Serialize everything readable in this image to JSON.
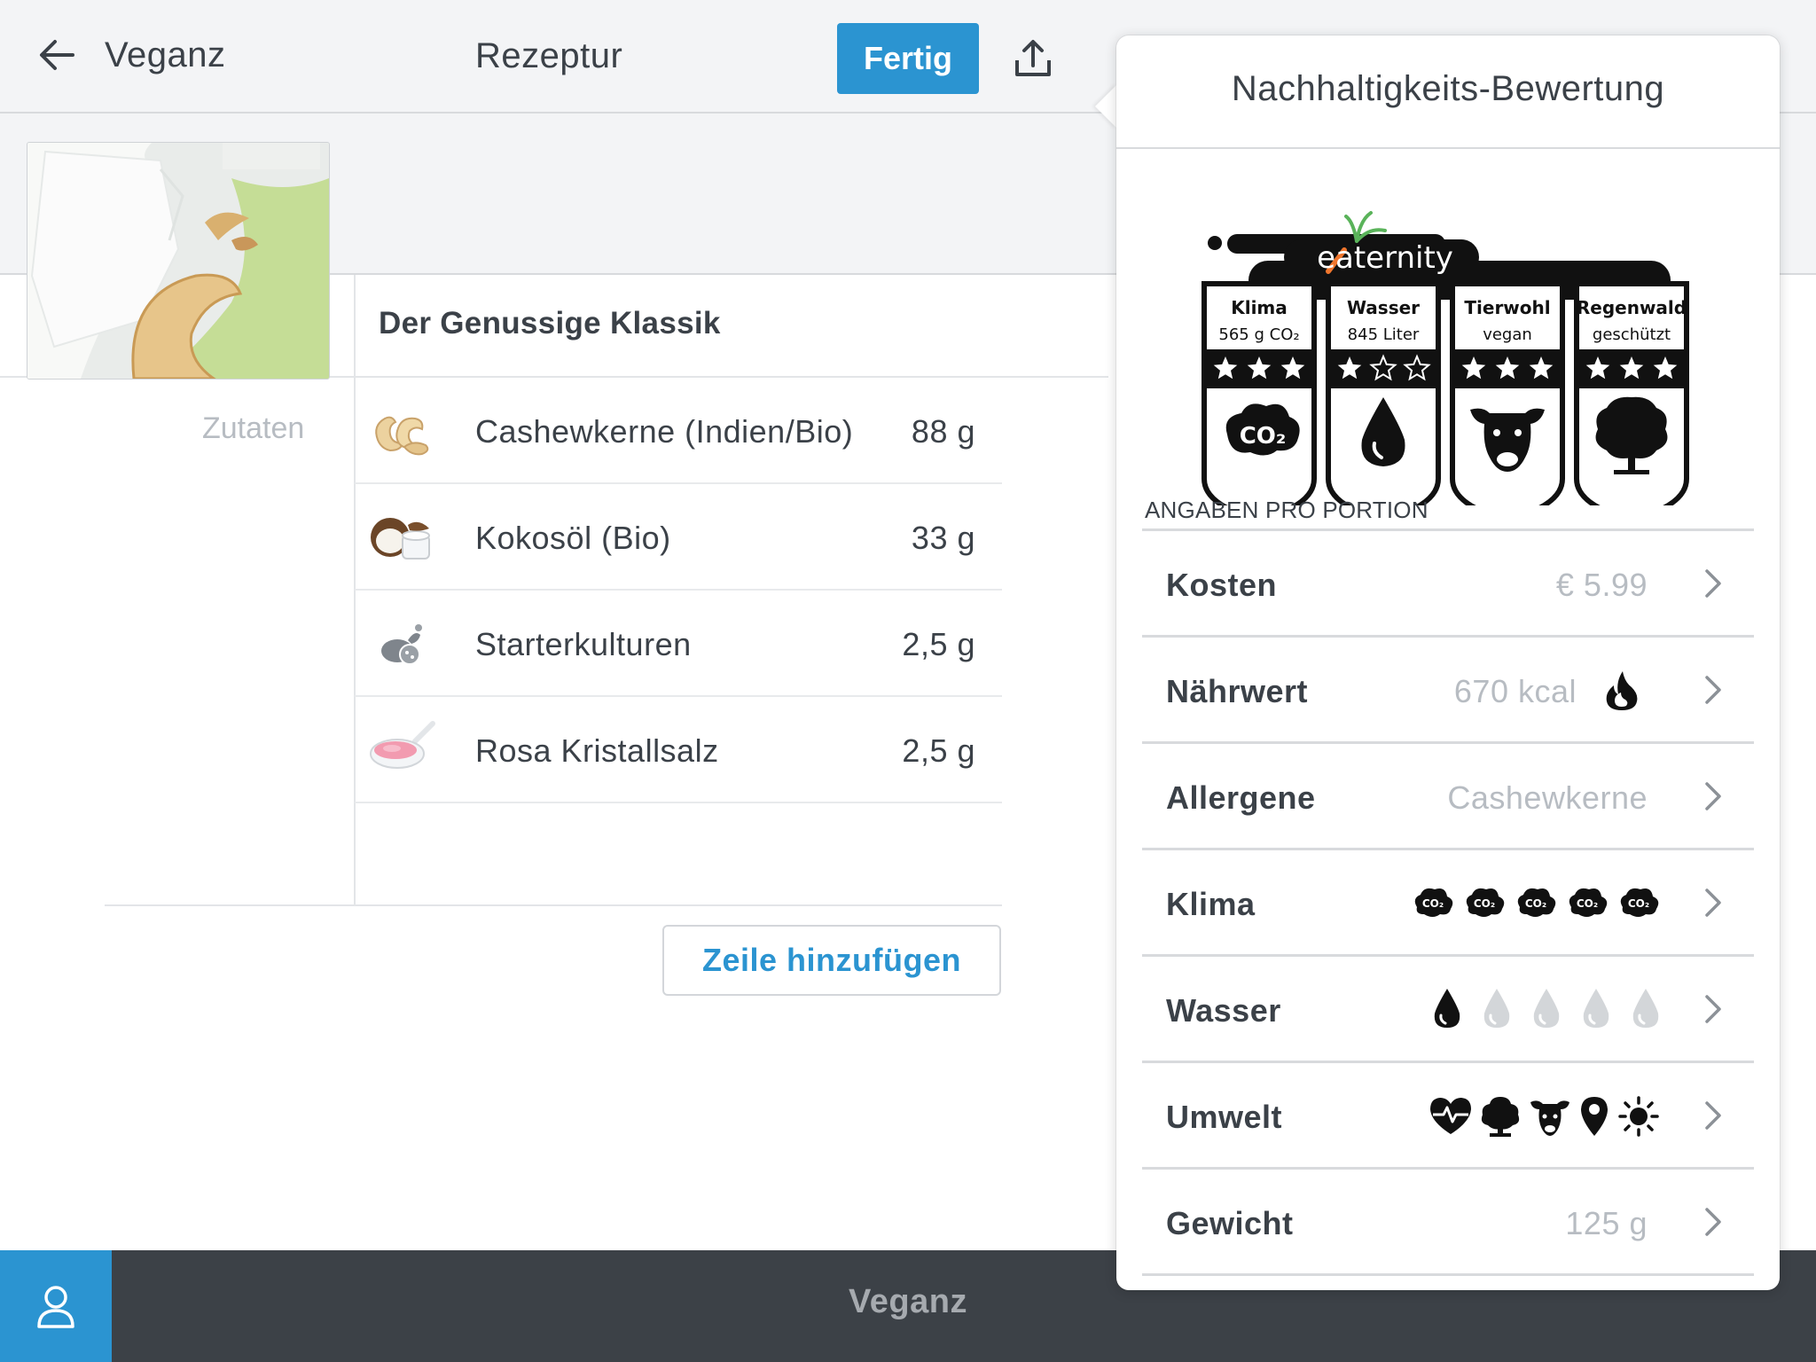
{
  "topbar": {
    "app_name": "Veganz",
    "title": "Rezeptur",
    "done_label": "Fertig"
  },
  "recipe": {
    "title": "Der Genussige Klassik",
    "ingredients_label": "Zutaten",
    "ingredients": [
      {
        "name": "Cashewkerne (Indien/Bio)",
        "amount": "88 g",
        "icon": "cashew-icon"
      },
      {
        "name": "Kokosöl (Bio)",
        "amount": "33 g",
        "icon": "coconut-icon"
      },
      {
        "name": "Starterkulturen",
        "amount": "2,5 g",
        "icon": "starter-culture-icon"
      },
      {
        "name": "Rosa Kristallsalz",
        "amount": "2,5 g",
        "icon": "pink-salt-icon"
      }
    ],
    "add_row_label": "Zeile hinzufügen"
  },
  "footer": {
    "title": "Veganz"
  },
  "popover": {
    "title": "Nachhaltigkeits-Bewertung",
    "label": {
      "brand": "eaternity",
      "columns": [
        {
          "name": "Klima",
          "value": "565 g CO₂",
          "stars": 3,
          "icon": "co2-cloud-icon"
        },
        {
          "name": "Wasser",
          "value": "845 Liter",
          "stars": 1,
          "icon": "water-drop-icon"
        },
        {
          "name": "Tierwohl",
          "value": "vegan",
          "stars": 3,
          "icon": "cow-icon"
        },
        {
          "name": "Regenwald",
          "value": "geschützt",
          "stars": 3,
          "icon": "tree-icon"
        }
      ]
    },
    "section_heading": "ANGABEN PRO PORTION",
    "metrics": {
      "cost": {
        "label": "Kosten",
        "value": "€ 5.99"
      },
      "nutrition": {
        "label": "Nährwert",
        "value": "670 kcal"
      },
      "allergens": {
        "label": "Allergene",
        "value": "Cashewkerne"
      },
      "climate": {
        "label": "Klima",
        "rating": 5,
        "max": 5
      },
      "water": {
        "label": "Wasser",
        "rating": 1,
        "max": 5
      },
      "environment": {
        "label": "Umwelt",
        "icons": [
          "heartbeat-icon",
          "tree-icon",
          "cow-icon",
          "location-pin-icon",
          "sun-icon"
        ]
      },
      "weight": {
        "label": "Gewicht",
        "value": "125 g"
      }
    }
  },
  "colors": {
    "accent": "#2b94d1",
    "text": "#3b4148",
    "muted": "#b7bcc2",
    "bar": "#3c4147"
  }
}
